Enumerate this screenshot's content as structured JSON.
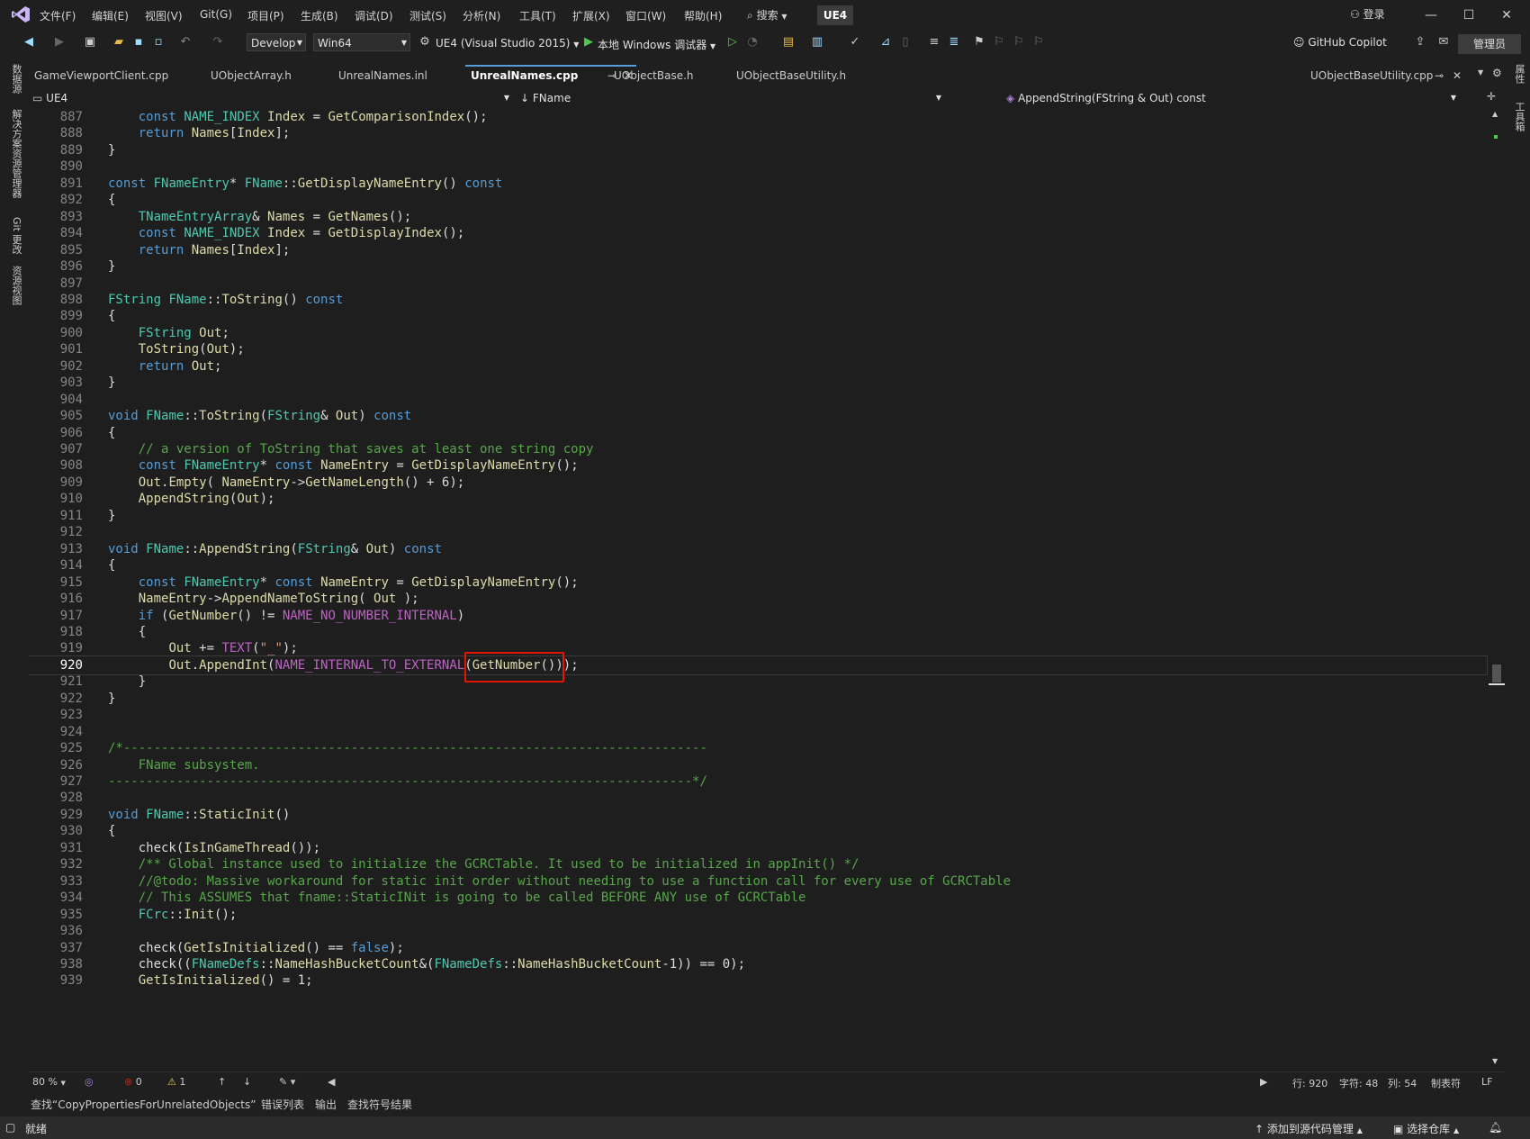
{
  "menubar": {
    "items": [
      "文件(F)",
      "编辑(E)",
      "视图(V)",
      "Git(G)",
      "项目(P)",
      "生成(B)",
      "调试(D)",
      "测试(S)",
      "分析(N)",
      "工具(T)",
      "扩展(X)",
      "窗口(W)",
      "帮助(H)"
    ],
    "search": "搜索",
    "solution_badge": "UE4",
    "login": "登录"
  },
  "toolbar": {
    "config": "Develop",
    "platform": "Win64",
    "project": "UE4 (Visual Studio 2015)",
    "debugger": "本地 Windows 调试器",
    "copilot": "GitHub Copilot",
    "admin": "管理员"
  },
  "left_strip": [
    "数据源",
    "解决方案资源管理器",
    "Git 更改",
    "资源视图"
  ],
  "right_strip": [
    "属性",
    "工具箱"
  ],
  "tabs": [
    "GameViewportClient.cpp",
    "UObjectArray.h",
    "UnrealNames.inl",
    "UnrealNames.cpp",
    "UObjectBase.h",
    "UObjectBaseUtility.h"
  ],
  "tab_right": "UObjectBaseUtility.cpp",
  "navbar": {
    "project": "UE4",
    "scope": "FName",
    "member": "AppendString(FString & Out) const"
  },
  "code": [
    {
      "n": "887",
      "t": "    const NAME_INDEX Index = GetComparisonIndex();"
    },
    {
      "n": "888",
      "t": "    return Names[Index];"
    },
    {
      "n": "889",
      "t": "}"
    },
    {
      "n": "890",
      "t": ""
    },
    {
      "n": "891",
      "t": "const FNameEntry* FName::GetDisplayNameEntry() const"
    },
    {
      "n": "892",
      "t": "{"
    },
    {
      "n": "893",
      "t": "    TNameEntryArray& Names = GetNames();"
    },
    {
      "n": "894",
      "t": "    const NAME_INDEX Index = GetDisplayIndex();"
    },
    {
      "n": "895",
      "t": "    return Names[Index];"
    },
    {
      "n": "896",
      "t": "}"
    },
    {
      "n": "897",
      "t": ""
    },
    {
      "n": "898",
      "t": "FString FName::ToString() const"
    },
    {
      "n": "899",
      "t": "{"
    },
    {
      "n": "900",
      "t": "    FString Out;"
    },
    {
      "n": "901",
      "t": "    ToString(Out);"
    },
    {
      "n": "902",
      "t": "    return Out;"
    },
    {
      "n": "903",
      "t": "}"
    },
    {
      "n": "904",
      "t": ""
    },
    {
      "n": "905",
      "t": "void FName::ToString(FString& Out) const"
    },
    {
      "n": "906",
      "t": "{"
    },
    {
      "n": "907",
      "t": "    // a version of ToString that saves at least one string copy"
    },
    {
      "n": "908",
      "t": "    const FNameEntry* const NameEntry = GetDisplayNameEntry();"
    },
    {
      "n": "909",
      "t": "    Out.Empty( NameEntry->GetNameLength() + 6);"
    },
    {
      "n": "910",
      "t": "    AppendString(Out);"
    },
    {
      "n": "911",
      "t": "}"
    },
    {
      "n": "912",
      "t": ""
    },
    {
      "n": "913",
      "t": "void FName::AppendString(FString& Out) const"
    },
    {
      "n": "914",
      "t": "{"
    },
    {
      "n": "915",
      "t": "    const FNameEntry* const NameEntry = GetDisplayNameEntry();"
    },
    {
      "n": "916",
      "t": "    NameEntry->AppendNameToString( Out );"
    },
    {
      "n": "917",
      "t": "    if (GetNumber() != NAME_NO_NUMBER_INTERNAL)"
    },
    {
      "n": "918",
      "t": "    {"
    },
    {
      "n": "919",
      "t": "        Out += TEXT(\"_\");"
    },
    {
      "n": "920",
      "t": "        Out.AppendInt(NAME_INTERNAL_TO_EXTERNAL(GetNumber()));"
    },
    {
      "n": "921",
      "t": "    }"
    },
    {
      "n": "922",
      "t": "}"
    },
    {
      "n": "923",
      "t": ""
    },
    {
      "n": "924",
      "t": ""
    },
    {
      "n": "925",
      "t": "/*-----------------------------------------------------------------------------"
    },
    {
      "n": "926",
      "t": "    FName subsystem."
    },
    {
      "n": "927",
      "t": "-----------------------------------------------------------------------------*/"
    },
    {
      "n": "928",
      "t": ""
    },
    {
      "n": "929",
      "t": "void FName::StaticInit()"
    },
    {
      "n": "930",
      "t": "{"
    },
    {
      "n": "931",
      "t": "    check(IsInGameThread());"
    },
    {
      "n": "932",
      "t": "    /** Global instance used to initialize the GCRCTable. It used to be initialized in appInit() */"
    },
    {
      "n": "933",
      "t": "    //@todo: Massive workaround for static init order without needing to use a function call for every use of GCRCTable"
    },
    {
      "n": "934",
      "t": "    // This ASSUMES that fname::StaticINit is going to be called BEFORE ANY use of GCRCTable"
    },
    {
      "n": "935",
      "t": "    FCrc::Init();"
    },
    {
      "n": "936",
      "t": ""
    },
    {
      "n": "937",
      "t": "    check(GetIsInitialized() == false);"
    },
    {
      "n": "938",
      "t": "    check((FNameDefs::NameHashBucketCount&(FNameDefs::NameHashBucketCount-1)) == 0);"
    },
    {
      "n": "939",
      "t": "    GetIsInitialized() = 1;"
    }
  ],
  "current_line": "920",
  "editor_status": {
    "zoom": "80 %",
    "errors": "0",
    "warnings": "1",
    "line": "行: 920",
    "char": "字符: 48",
    "col": "列: 54",
    "tabs": "制表符",
    "eol": "LF"
  },
  "bottom_tabs": [
    "查找“CopyPropertiesForUnrelatedObjects”",
    "错误列表",
    "输出",
    "查找符号结果"
  ],
  "statusbar": {
    "ready": "就绪",
    "source_control": "添加到源代码管理",
    "repo": "选择仓库"
  },
  "colors": {
    "keyword": "#569cd6",
    "type": "#4ec9b0",
    "function": "#dcdcaa",
    "comment": "#57a64a",
    "string": "#d69d85",
    "highlight_border": "#e51400"
  }
}
